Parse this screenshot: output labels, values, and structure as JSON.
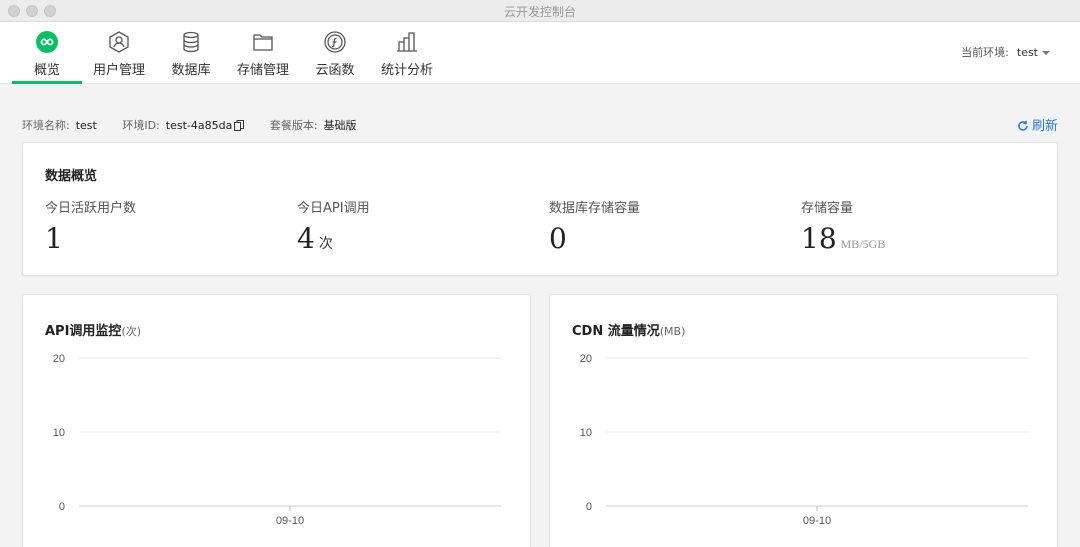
{
  "window": {
    "title": "云开发控制台"
  },
  "nav": {
    "items": [
      {
        "label": "概览",
        "icon": "infinity-icon"
      },
      {
        "label": "用户管理",
        "icon": "user-icon"
      },
      {
        "label": "数据库",
        "icon": "database-icon"
      },
      {
        "label": "存储管理",
        "icon": "folder-icon"
      },
      {
        "label": "云函数",
        "icon": "function-icon"
      },
      {
        "label": "统计分析",
        "icon": "bar-chart-icon"
      }
    ],
    "active_index": 0,
    "env_label": "当前环境:",
    "env_value": "test"
  },
  "info": {
    "env_name_label": "环境名称:",
    "env_name": "test",
    "env_id_label": "环境ID:",
    "env_id": "test-4a85da",
    "plan_label": "套餐版本:",
    "plan": "基础版",
    "refresh_label": "刷新"
  },
  "overview": {
    "title": "数据概览",
    "stats": [
      {
        "label": "今日活跃用户数",
        "value": "1",
        "unit": ""
      },
      {
        "label": "今日API调用",
        "value": "4",
        "unit": "次"
      },
      {
        "label": "数据库存储容量",
        "value": "0",
        "unit": ""
      },
      {
        "label": "存储容量",
        "value": "18",
        "unit": "MB/5GB"
      }
    ]
  },
  "chart_data": [
    {
      "type": "line",
      "title": "API调用监控",
      "unit": "(次)",
      "x": [
        "09-10"
      ],
      "series": [],
      "ylim": [
        0,
        20
      ],
      "yticks": [
        "20",
        "10",
        "0"
      ],
      "grid": true
    },
    {
      "type": "line",
      "title": "CDN 流量情况",
      "unit": "(MB)",
      "x": [
        "09-10"
      ],
      "series": [],
      "ylim": [
        0,
        20
      ],
      "yticks": [
        "20",
        "10",
        "0"
      ],
      "grid": true
    }
  ],
  "colors": {
    "accent": "#07c160",
    "link": "#2a7ae2"
  }
}
